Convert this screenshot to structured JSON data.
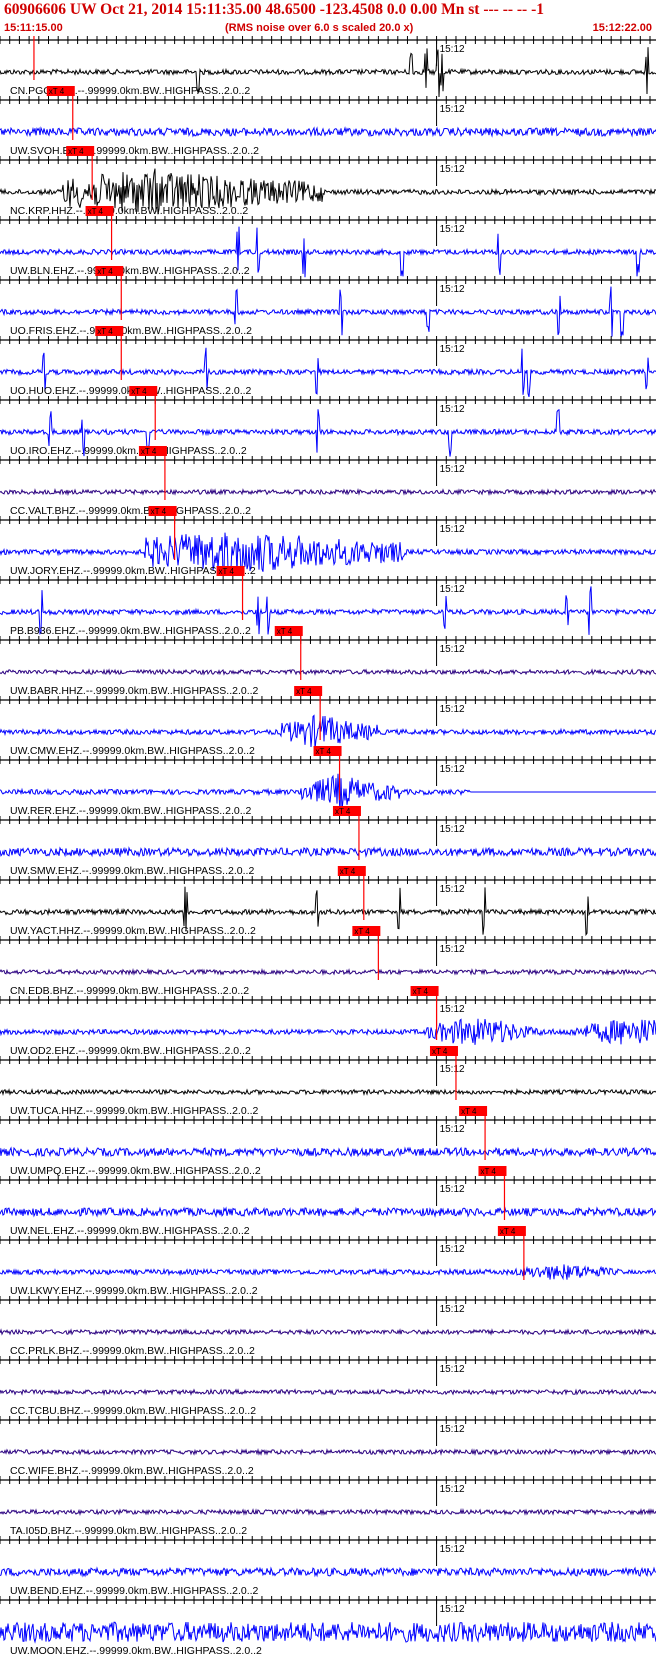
{
  "header": {
    "title": "60906606 UW Oct 21, 2014 15:11:35.00   48.6500 -123.4508  0.0 0.00 Mn st --- -- --  -1",
    "start_time": "15:11:15.00",
    "note": "(RMS noise over 6.0 s scaled 20.0 x)",
    "end_time": "15:12:22.00"
  },
  "colors": {
    "header_text": "#d00000",
    "trace_blue": "#0000ff",
    "trace_black": "#000000",
    "trace_purple": "#2a0080",
    "pick_red": "#ff0000",
    "axis": "#000000"
  },
  "chart_data": {
    "type": "seismogram",
    "x_range": [
      "15:11:15.00",
      "15:12:22.00"
    ],
    "minute_label": "15:12",
    "pick_label": "xT 4",
    "series": [
      {
        "name": "CN.PGC.BHZ.--.99999.0km.BW..HIGHPASS..2.0..2",
        "color": "trace_black",
        "pick": "15:11:18.5",
        "activity": "spikes"
      },
      {
        "name": "UW.SVOH.EHZ.--.99999.0km.BW..HIGHPASS..2.0..2",
        "color": "trace_blue",
        "pick": "15:11:22.5",
        "activity": "noisy"
      },
      {
        "name": "NC.KRP.HHZ.--.99999.0km.BW..HIGHPASS..2.0..2",
        "color": "trace_black",
        "pick": "15:11:24.5",
        "activity": "burst"
      },
      {
        "name": "UW.BLN.EHZ.--.99999.0km.BW..HIGHPASS..2.0..2",
        "color": "trace_blue",
        "pick": "15:11:26.5",
        "activity": "spikes"
      },
      {
        "name": "UO.FRIS.EHZ.--.99999.0km.BW..HIGHPASS..2.0..2",
        "color": "trace_blue",
        "pick": "15:11:27.5",
        "activity": "spikes"
      },
      {
        "name": "UO.HUO.EHZ.--.99999.0km.BW..HIGHPASS..2.0..2",
        "color": "trace_blue",
        "pick": "15:11:27.5",
        "activity": "spikes"
      },
      {
        "name": "UO.IRO.EHZ.--.99999.0km.BW..HIGHPASS..2.0..2",
        "color": "trace_blue",
        "pick": "15:11:31.0",
        "activity": "spikes"
      },
      {
        "name": "CC.VALT.BHZ.--.99999.0km.BW..HIGHPASS..2.0..2",
        "color": "trace_purple",
        "pick": "15:11:32.0",
        "activity": "quiet"
      },
      {
        "name": "UW.JORY.EHZ.--.99999.0km.BW..HIGHPASS..2.0..2",
        "color": "trace_blue",
        "pick": "15:11:33.0",
        "activity": "burst"
      },
      {
        "name": "PB.B936.EHZ.--.99999.0km.BW..HIGHPASS..2.0..2",
        "color": "trace_blue",
        "pick": "15:11:40.0",
        "activity": "spikes"
      },
      {
        "name": "UW.BABR.HHZ.--.99999.0km.BW..HIGHPASS..2.0..2",
        "color": "trace_purple",
        "pick": "15:11:46.0",
        "activity": "quiet"
      },
      {
        "name": "UW.CMW.EHZ.--.99999.0km.BW..HIGHPASS..2.0..2",
        "color": "trace_blue",
        "pick": "15:11:48.0",
        "activity": "event"
      },
      {
        "name": "UW.RER.EHZ.--.99999.0km.BW..HIGHPASS..2.0..2",
        "color": "trace_blue",
        "pick": "15:11:50.0",
        "activity": "event_short"
      },
      {
        "name": "UW.SMW.EHZ.--.99999.0km.BW..HIGHPASS..2.0..2",
        "color": "trace_blue",
        "pick": "15:11:52.0",
        "activity": "noisy"
      },
      {
        "name": "UW.YACT.HHZ.--.99999.0km.BW..HIGHPASS..2.0..2",
        "color": "trace_black",
        "pick": "15:11:52.5",
        "activity": "spikes"
      },
      {
        "name": "CN.EDB.BHZ.--.99999.0km.BW..HIGHPASS..2.0..2",
        "color": "trace_purple",
        "pick": "15:11:54.0",
        "activity": "quiet"
      },
      {
        "name": "UW.OD2.EHZ.--.99999.0km.BW..HIGHPASS..2.0..2",
        "color": "trace_blue",
        "pick": "15:12:00.0",
        "activity": "late_burst"
      },
      {
        "name": "UW.TUCA.HHZ.--.99999.0km.BW..HIGHPASS..2.0..2",
        "color": "trace_black",
        "pick": "15:12:02.0",
        "activity": "quiet"
      },
      {
        "name": "UW.UMPQ.EHZ.--.99999.0km.BW..HIGHPASS..2.0..2",
        "color": "trace_blue",
        "pick": "15:12:05.0",
        "activity": "noisy"
      },
      {
        "name": "UW.NEL.EHZ.--.99999.0km.BW..HIGHPASS..2.0..2",
        "color": "trace_blue",
        "pick": "15:12:07.0",
        "activity": "noisy"
      },
      {
        "name": "UW.LKWY.EHZ.--.99999.0km.BW..HIGHPASS..2.0..2",
        "color": "trace_blue",
        "pick": "15:12:09.0",
        "activity": "late_burst_small"
      },
      {
        "name": "CC.PRLK.BHZ.--.99999.0km.BW..HIGHPASS..2.0..2",
        "color": "trace_purple",
        "pick": null,
        "activity": "quiet"
      },
      {
        "name": "CC.TCBU.BHZ.--.99999.0km.BW..HIGHPASS..2.0..2",
        "color": "trace_purple",
        "pick": null,
        "activity": "quiet"
      },
      {
        "name": "CC.WIFE.BHZ.--.99999.0km.BW..HIGHPASS..2.0..2",
        "color": "trace_purple",
        "pick": null,
        "activity": "quiet"
      },
      {
        "name": "TA.I05D.BHZ.--.99999.0km.BW..HIGHPASS..2.0..2",
        "color": "trace_purple",
        "pick": null,
        "activity": "quiet"
      },
      {
        "name": "UW.BEND.EHZ.--.99999.0km.BW..HIGHPASS..2.0..2",
        "color": "trace_blue",
        "pick": null,
        "activity": "noisy"
      },
      {
        "name": "UW.MOON.EHZ.--.99999.0km.BW..HIGHPASS..2.0..2",
        "color": "trace_blue",
        "pick": null,
        "activity": "very_noisy"
      }
    ]
  }
}
